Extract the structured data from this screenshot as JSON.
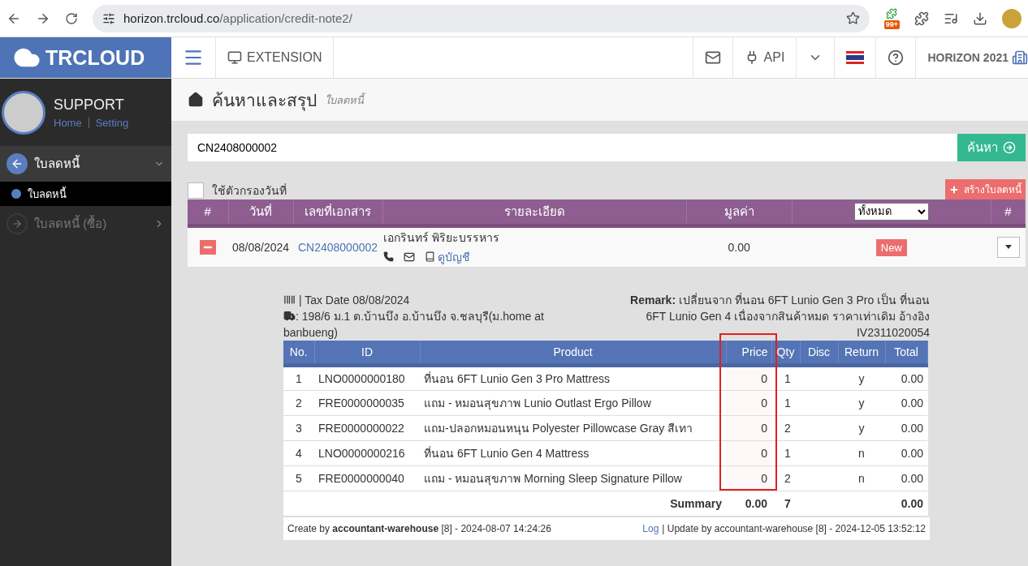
{
  "browser": {
    "url_host": "horizon.trcloud.co",
    "url_path": "/application/credit-note2/",
    "extension_badge": "99+"
  },
  "header": {
    "logo": "TRCLOUD",
    "extension": "EXTENSION",
    "api": "API",
    "company": "HORIZON 2021"
  },
  "sidebar": {
    "user": "SUPPORT",
    "links": [
      "Home",
      "Setting"
    ],
    "items": [
      {
        "label": "ใบลดหนี้",
        "expanded": true,
        "disabled": false,
        "children": [
          {
            "label": "ใบลดหนี้",
            "selected": true
          }
        ]
      },
      {
        "label": "ใบลดหนี้ (ซื้อ)",
        "expanded": false,
        "disabled": true
      }
    ]
  },
  "page": {
    "title": "ค้นหาและสรุป",
    "subtitle": "ใบลดหนี้"
  },
  "search": {
    "value": "CN2408000002",
    "button": "ค้นหา"
  },
  "filter": {
    "label": "ใช้ตัวกรองวันที่",
    "checked": false
  },
  "create_button": "สร้างใบลดหนี้",
  "list": {
    "columns": [
      "#",
      "วันที่",
      "เลขที่เอกสาร",
      "รายละเอียด",
      "มูลค่า",
      "#"
    ],
    "status_filter": "ทั้งหมด",
    "rows": [
      {
        "expanded": true,
        "date": "08/08/2024",
        "doc_no": "CN2408000002",
        "name": "เอกรินทร์ พิริยะบรรหาร",
        "account_link": "ดูบัญชี",
        "value": "0.00",
        "status": "New"
      }
    ]
  },
  "detail": {
    "tax_date": "| Tax Date 08/08/2024",
    "address": ": 198/6 ม.1 ต.บ้านบึง อ.บ้านบึง จ.ชลบุรี(ม.home at banbueng)",
    "remark": "**Remark:** เปลี่ยนจาก ที่นอน 6FT Lunio Gen 3 Pro เป็น ที่นอน 6FT Lunio Gen 4 เนื่องจากสินค้าหมด ราคาเท่าเดิม อ้างอิง IV2311020054",
    "columns": [
      "No.",
      "ID",
      "Product",
      "Price",
      "Qty",
      "Disc",
      "Return",
      "Total"
    ],
    "rows": [
      [
        "1",
        "LNO0000000180",
        "ที่นอน 6FT Lunio Gen 3 Pro Mattress",
        "0",
        "1",
        "",
        "y",
        "0.00"
      ],
      [
        "2",
        "FRE0000000035",
        "แถม - หมอนสุขภาพ Lunio Outlast Ergo Pillow",
        "0",
        "1",
        "",
        "y",
        "0.00"
      ],
      [
        "3",
        "FRE0000000022",
        "แถม-ปลอกหมอนหนุน Polyester Pillowcase Gray สีเทา",
        "0",
        "2",
        "",
        "y",
        "0.00"
      ],
      [
        "4",
        "LNO0000000216",
        "ที่นอน 6FT Lunio Gen 4 Mattress",
        "0",
        "1",
        "",
        "n",
        "0.00"
      ],
      [
        "5",
        "FRE0000000040",
        "แถม - หมอนสุขภาพ Morning Sleep Signature Pillow",
        "0",
        "2",
        "",
        "n",
        "0.00"
      ]
    ],
    "summary": {
      "label": "Summary",
      "price": "0.00",
      "qty": "7",
      "total": "0.00"
    },
    "created": "Create by **accountant-warehouse** [8] - 2024-08-07 14:24:26",
    "log_link": "Log",
    "updated": "| Update by accountant-warehouse [8] - 2024-12-05 13:52:12"
  }
}
